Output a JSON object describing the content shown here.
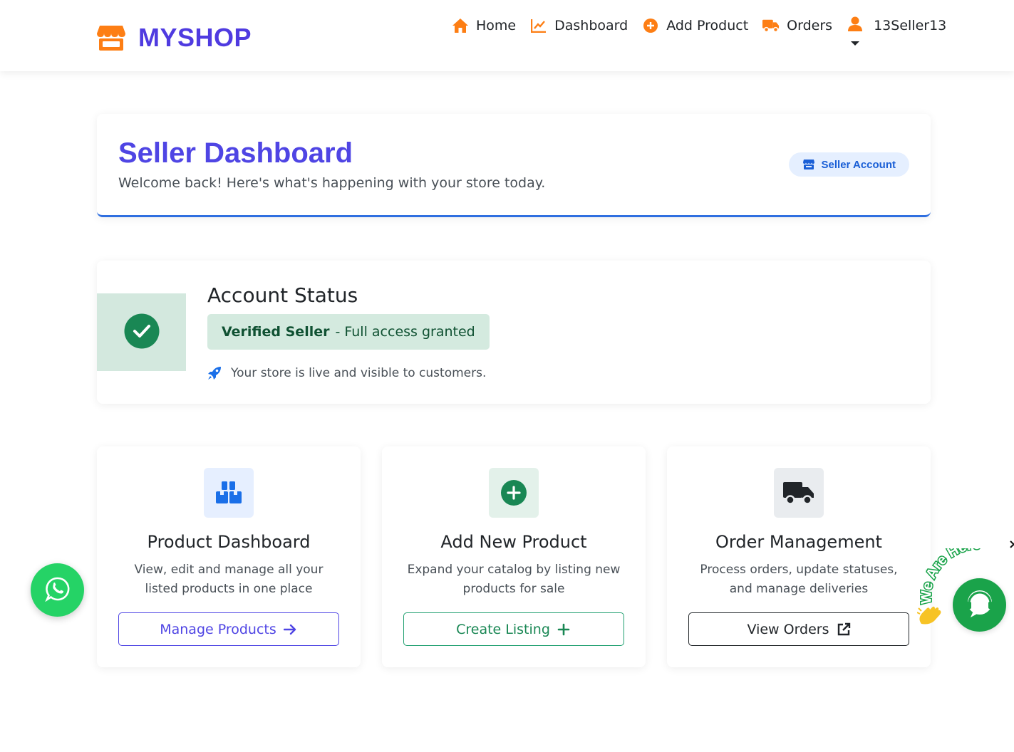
{
  "brand": {
    "name": "MYSHOP",
    "color": "#4f3be0",
    "icon": "store-icon"
  },
  "nav": {
    "items": [
      {
        "label": "Home",
        "icon": "home-icon"
      },
      {
        "label": "Dashboard",
        "icon": "chart-line-icon"
      },
      {
        "label": "Add Product",
        "icon": "plus-circle-icon"
      },
      {
        "label": "Orders",
        "icon": "truck-icon"
      }
    ],
    "user": {
      "label": "13Seller13",
      "icon": "user-icon"
    },
    "icon_color": "#fd7e14"
  },
  "header": {
    "title": "Seller Dashboard",
    "subtitle": "Welcome back! Here's what's happening with your store today.",
    "badge": "Seller Account"
  },
  "status": {
    "title": "Account Status",
    "verified_strong": "Verified Seller",
    "verified_rest": "- Full access granted",
    "live_text": "Your store is live and visible to customers."
  },
  "cards": [
    {
      "title": "Product Dashboard",
      "desc": "View, edit and manage all your listed products in one place",
      "button": "Manage Products",
      "icon": "boxes-icon"
    },
    {
      "title": "Add New Product",
      "desc": "Expand your catalog by listing new products for sale",
      "button": "Create Listing",
      "icon": "plus-circle-icon"
    },
    {
      "title": "Order Management",
      "desc": "Process orders, update statuses, and manage deliveries",
      "button": "View Orders",
      "icon": "truck-icon"
    }
  ],
  "chat_widget": {
    "label": "We Are Here",
    "close": "×"
  },
  "colors": {
    "primary": "#4f45e4",
    "success": "#198754",
    "info": "#1a5fd6",
    "accent": "#fd7e14"
  }
}
